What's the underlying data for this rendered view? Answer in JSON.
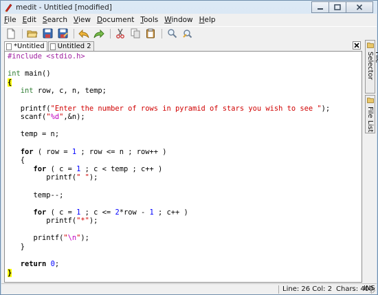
{
  "window": {
    "title": "medit - Untitled [modified]",
    "controls": {
      "minimize": "▭",
      "maximize": "▢",
      "close": "✕"
    }
  },
  "menu": [
    {
      "mnemonic": "F",
      "rest": "ile"
    },
    {
      "mnemonic": "E",
      "rest": "dit"
    },
    {
      "mnemonic": "S",
      "rest": "earch"
    },
    {
      "mnemonic": "V",
      "rest": "iew"
    },
    {
      "mnemonic": "D",
      "rest": "ocument"
    },
    {
      "mnemonic": "T",
      "rest": "ools"
    },
    {
      "mnemonic": "W",
      "rest": "indow"
    },
    {
      "mnemonic": "H",
      "rest": "elp"
    }
  ],
  "toolbar": {
    "icons": [
      "new-file-icon",
      "open-folder-icon",
      "save-icon",
      "save-as-icon",
      "undo-icon",
      "redo-icon",
      "cut-icon",
      "copy-icon",
      "paste-icon",
      "find-icon",
      "find-replace-icon"
    ]
  },
  "tabs": [
    {
      "label": "*Untitled",
      "active": true
    },
    {
      "label": "Untitled 2",
      "active": false
    }
  ],
  "side_panel": {
    "tabs": [
      "File Selector",
      "File List"
    ]
  },
  "code_lines": [
    "#include <stdio.h>",
    "",
    "int main()",
    "{",
    "   int row, c, n, temp;",
    "",
    "   printf(\"Enter the number of rows in pyramid of stars you wish to see \");",
    "   scanf(\"%d\",&n);",
    "",
    "   temp = n;",
    "",
    "   for ( row = 1 ; row <= n ; row++ )",
    "   {",
    "      for ( c = 1 ; c < temp ; c++ )",
    "         printf(\" \");",
    "",
    "      temp--;",
    "",
    "      for ( c = 1 ; c <= 2*row - 1 ; c++ )",
    "         printf(\"*\");",
    "",
    "      printf(\"\\n\");",
    "   }",
    "",
    "   return 0;",
    "}"
  ],
  "status": {
    "position": "Line: 26 Col: 2",
    "chars": "Chars: 400",
    "mode": "INS"
  },
  "colors": {
    "preprocessor": "#a020a0",
    "string": "#d00000",
    "number": "#0000ff",
    "format_spec": "#c000c0",
    "brace_highlight": "#ffff00"
  }
}
